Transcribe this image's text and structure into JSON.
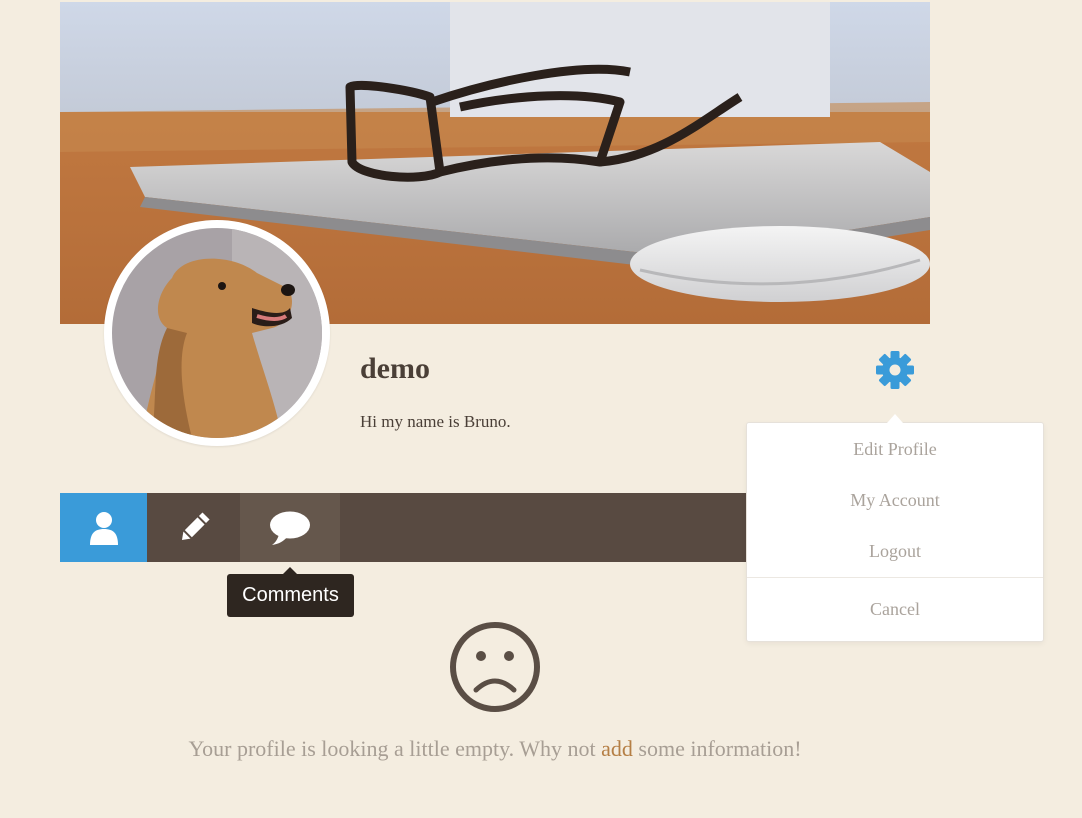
{
  "profile": {
    "username": "demo",
    "bio": "Hi my name is Bruno."
  },
  "images": {
    "cover": "cover-photo-laptop-glasses-mouse",
    "avatar": "avatar-golden-retriever"
  },
  "tabs": [
    {
      "id": "about",
      "icon": "user-icon",
      "active": true
    },
    {
      "id": "posts",
      "icon": "pencil-icon",
      "active": false
    },
    {
      "id": "comments",
      "icon": "speech-bubble-icon",
      "active": false
    }
  ],
  "tooltip": {
    "text": "Comments"
  },
  "settings_menu": {
    "icon": "gear-icon",
    "items": [
      "Edit Profile",
      "My Account",
      "Logout"
    ],
    "cancel": "Cancel"
  },
  "empty_state": {
    "icon": "sad-face-icon",
    "text_before": "Your profile is looking a little empty. Why not ",
    "link_text": "add",
    "text_after": " some information!"
  },
  "colors": {
    "background": "#f4ede0",
    "tab_bar": "#584a41",
    "tab_active": "#3a9bd9",
    "gear": "#3a9bd9",
    "link": "#b57f45",
    "muted_text": "#a79e94"
  }
}
